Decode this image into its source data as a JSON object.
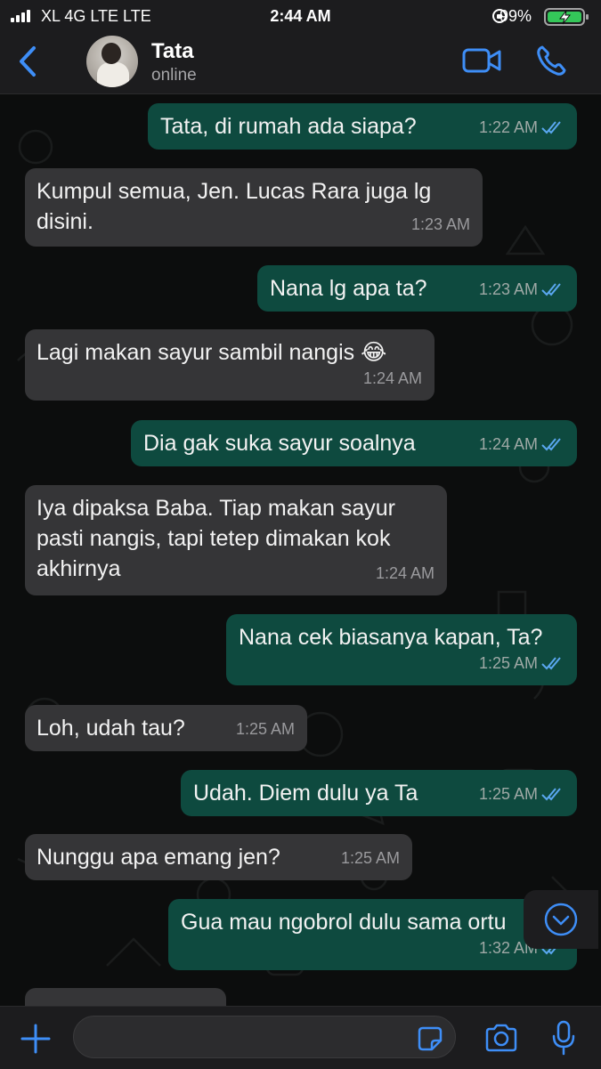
{
  "status_bar": {
    "carrier": "XL 4G LTE  LTE",
    "time": "2:44 AM",
    "battery": "99%"
  },
  "header": {
    "contact_name": "Tata",
    "contact_status": "online"
  },
  "messages": [
    {
      "dir": "out",
      "text": "Tata, di rumah ada siapa?",
      "time": "1:22 AM",
      "read": true
    },
    {
      "dir": "in",
      "text": "Kumpul semua, Jen. Lucas Rara juga lg disini.",
      "time": "1:23 AM"
    },
    {
      "dir": "out",
      "text": "Nana lg apa ta?",
      "time": "1:23 AM",
      "read": true
    },
    {
      "dir": "in",
      "text": "Lagi makan sayur sambil nangis 😂",
      "time": "1:24 AM"
    },
    {
      "dir": "out",
      "text": "Dia gak suka sayur soalnya",
      "time": "1:24 AM",
      "read": true
    },
    {
      "dir": "in",
      "text": "Iya dipaksa Baba. Tiap makan sayur pasti nangis, tapi tetep dimakan kok akhirnya",
      "time": "1:24 AM"
    },
    {
      "dir": "out",
      "text": "Nana cek biasanya kapan, Ta?",
      "time": "1:25 AM",
      "read": true
    },
    {
      "dir": "in",
      "text": "Loh, udah tau?",
      "time": "1:25 AM"
    },
    {
      "dir": "out",
      "text": "Udah. Diem dulu ya Ta",
      "time": "1:25 AM",
      "read": true
    },
    {
      "dir": "in",
      "text": "Nunggu apa emang jen?",
      "time": "1:25 AM"
    },
    {
      "dir": "out",
      "text": "Gua mau ngobrol dulu sama ortu",
      "time": "1:32 AM",
      "read": true
    }
  ],
  "composer": {
    "placeholder": "",
    "value": ""
  },
  "colors": {
    "accent": "#3e8ef7",
    "bubble_out": "#0e4a3f",
    "bubble_in": "#353537",
    "read_tick": "#5aa7f0"
  },
  "icons": {
    "back": "chevron-left-icon",
    "video": "video-camera-icon",
    "phone": "phone-icon",
    "scroll_down": "chevron-down-circle-icon",
    "plus": "plus-icon",
    "sticker": "sticker-icon",
    "camera": "camera-icon",
    "mic": "microphone-icon"
  }
}
